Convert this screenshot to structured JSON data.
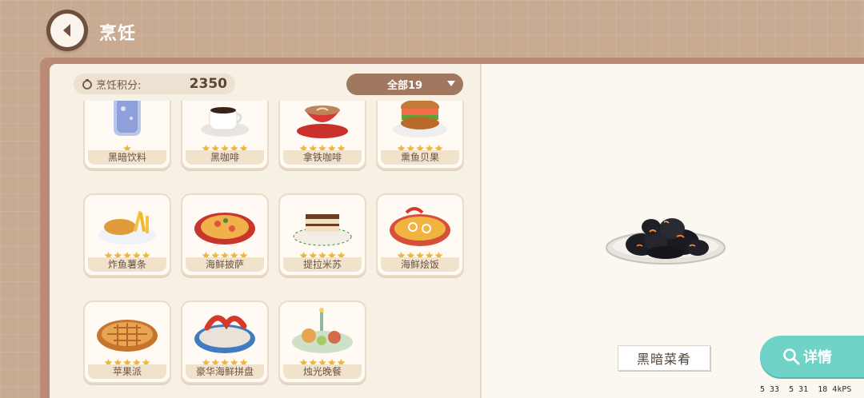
{
  "header": {
    "title": "烹饪"
  },
  "score": {
    "label": "烹饪积分:",
    "value": "2350"
  },
  "filter": {
    "selected": "全部19"
  },
  "dishes": [
    {
      "name": "黑暗饮料",
      "stars": 1,
      "icon": "dark-drink-icon"
    },
    {
      "name": "黑咖啡",
      "stars": 5,
      "icon": "black-coffee-icon"
    },
    {
      "name": "拿铁咖啡",
      "stars": 5,
      "icon": "latte-icon"
    },
    {
      "name": "熏鱼贝果",
      "stars": 5,
      "icon": "smoked-fish-bagel-icon"
    },
    {
      "name": "炸鱼薯条",
      "stars": 5,
      "icon": "fish-and-chips-icon"
    },
    {
      "name": "海鲜披萨",
      "stars": 5,
      "icon": "seafood-pizza-icon"
    },
    {
      "name": "提拉米苏",
      "stars": 5,
      "icon": "tiramisu-icon"
    },
    {
      "name": "海鲜烩饭",
      "stars": 5,
      "icon": "seafood-paella-icon"
    },
    {
      "name": "苹果派",
      "stars": 5,
      "icon": "apple-pie-icon"
    },
    {
      "name": "豪华海鲜拼盘",
      "stars": 5,
      "icon": "seafood-platter-icon"
    },
    {
      "name": "烛光晚餐",
      "stars": 5,
      "icon": "candlelight-dinner-icon"
    }
  ],
  "selected_dish": {
    "name": "黑暗菜肴",
    "icon": "dark-dish-icon"
  },
  "detail_button": {
    "label": "详情"
  },
  "debug": [
    "5 33",
    "5 31",
    "18 4kPS"
  ],
  "colors": {
    "accent": "#6fd3c7",
    "star": "#f5b727",
    "brown": "#a0775f"
  }
}
